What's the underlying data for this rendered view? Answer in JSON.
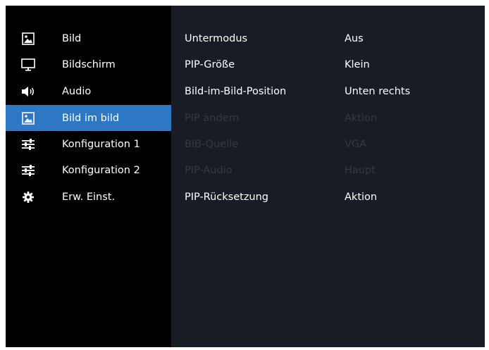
{
  "sidebar": {
    "items": [
      {
        "label": "Bild",
        "icon": "picture-icon",
        "selected": false
      },
      {
        "label": "Bildschirm",
        "icon": "monitor-icon",
        "selected": false
      },
      {
        "label": "Audio",
        "icon": "speaker-icon",
        "selected": false
      },
      {
        "label": "Bild im bild",
        "icon": "picture-in-picture-icon",
        "selected": true
      },
      {
        "label": "Konfiguration 1",
        "icon": "sliders-icon",
        "selected": false
      },
      {
        "label": "Konfiguration 2",
        "icon": "sliders-icon",
        "selected": false
      },
      {
        "label": "Erw. Einst.",
        "icon": "gear-icon",
        "selected": false
      }
    ]
  },
  "settings": {
    "rows": [
      {
        "name": "Untermodus",
        "value": "Aus",
        "enabled": true
      },
      {
        "name": "PIP-Größe",
        "value": "Klein",
        "enabled": true
      },
      {
        "name": "Bild-im-Bild-Position",
        "value": "Unten rechts",
        "enabled": true
      },
      {
        "name": "PIP ändern",
        "value": "Aktion",
        "enabled": false
      },
      {
        "name": "BiB-Quelle",
        "value": "VGA",
        "enabled": false
      },
      {
        "name": "PIP-Audio",
        "value": "Haupt",
        "enabled": false
      },
      {
        "name": "PIP-Rücksetzung",
        "value": "Aktion",
        "enabled": true
      }
    ]
  },
  "colors": {
    "selection": "#2d77c5",
    "content_background": "#181c24",
    "text": "#ffffff",
    "disabled_text": "#323944"
  }
}
